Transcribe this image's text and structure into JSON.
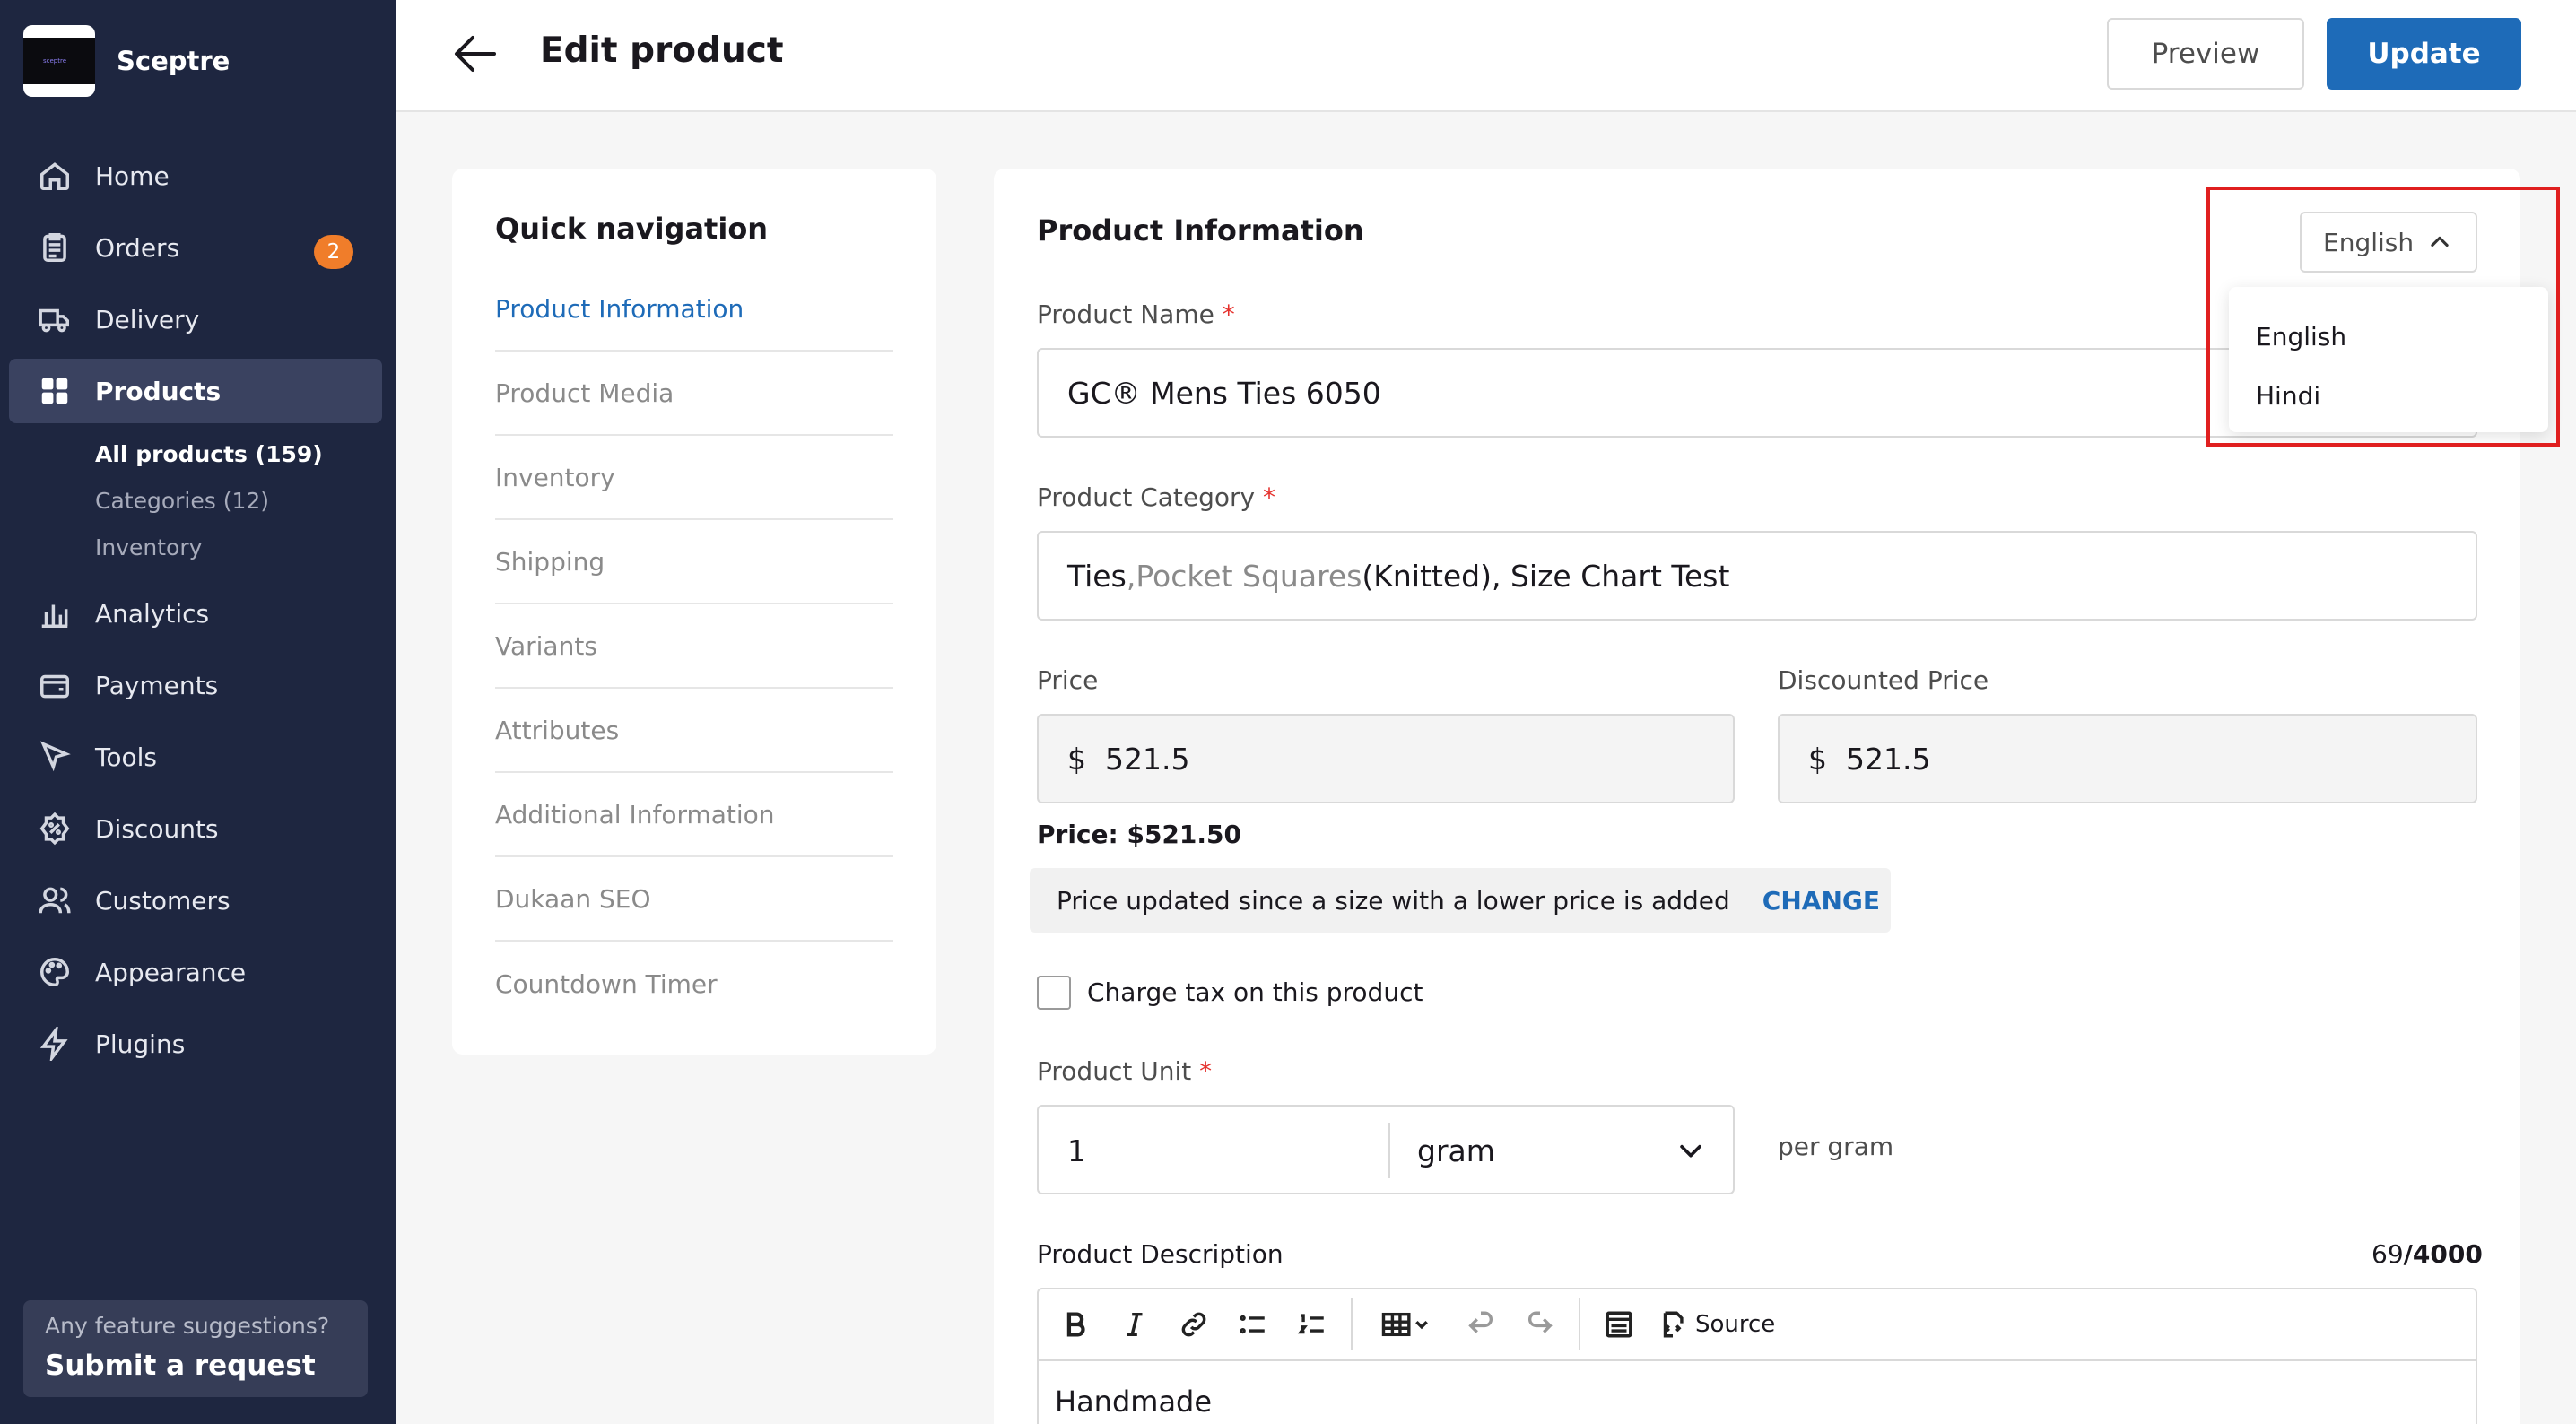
{
  "brand": {
    "name": "Sceptre",
    "logo_text": "sceptre"
  },
  "sidebar": {
    "items": [
      {
        "label": "Home",
        "icon": "home-icon"
      },
      {
        "label": "Orders",
        "icon": "orders-icon",
        "badge": "2"
      },
      {
        "label": "Delivery",
        "icon": "truck-icon"
      },
      {
        "label": "Products",
        "icon": "grid-icon",
        "active": true
      },
      {
        "label": "Analytics",
        "icon": "chart-icon"
      },
      {
        "label": "Payments",
        "icon": "wallet-icon"
      },
      {
        "label": "Tools",
        "icon": "cursor-icon"
      },
      {
        "label": "Discounts",
        "icon": "discount-icon"
      },
      {
        "label": "Customers",
        "icon": "users-icon"
      },
      {
        "label": "Appearance",
        "icon": "palette-icon"
      },
      {
        "label": "Plugins",
        "icon": "bolt-icon"
      }
    ],
    "subitems": [
      {
        "label": "All products (159)",
        "active": true
      },
      {
        "label": "Categories (12)"
      },
      {
        "label": "Inventory"
      }
    ],
    "suggest": {
      "question": "Any feature suggestions?",
      "cta": "Submit a request"
    }
  },
  "header": {
    "title": "Edit product",
    "preview_label": "Preview",
    "update_label": "Update"
  },
  "quicknav": {
    "title": "Quick navigation",
    "items": [
      "Product Information",
      "Product Media",
      "Inventory",
      "Shipping",
      "Variants",
      "Attributes",
      "Additional Information",
      "Dukaan SEO",
      "Countdown Timer"
    ]
  },
  "form": {
    "section_title": "Product Information",
    "language": {
      "selected": "English",
      "options": [
        "English",
        "Hindi"
      ]
    },
    "product_name": {
      "label": "Product Name",
      "required": "*",
      "value": "GC® Mens Ties 6050"
    },
    "product_category": {
      "label": "Product Category",
      "required": "*",
      "parts": [
        "Ties",
        ", ",
        "Pocket Squares",
        " (Knitted), Size Chart Test"
      ]
    },
    "price": {
      "label": "Price",
      "currency": "$",
      "value": "521.5"
    },
    "discounted_price": {
      "label": "Discounted Price",
      "currency": "$",
      "value": "521.5"
    },
    "price_summary": "Price: $521.50",
    "notice": {
      "text": "Price updated since a size with a lower price is added",
      "action": "CHANGE"
    },
    "tax": {
      "label": "Charge tax on this product",
      "checked": false
    },
    "product_unit": {
      "label": "Product Unit",
      "required": "*",
      "quantity": "1",
      "unit": "gram",
      "per_label": "per gram"
    },
    "description": {
      "label": "Product Description",
      "count": "69",
      "max": "/4000",
      "source_label": "Source",
      "content": "Handmade"
    }
  },
  "colors": {
    "sidebar_bg": "#1e2640",
    "accent": "#1e6bb8",
    "badge": "#f07d2a",
    "highlight": "#e01f1f"
  }
}
